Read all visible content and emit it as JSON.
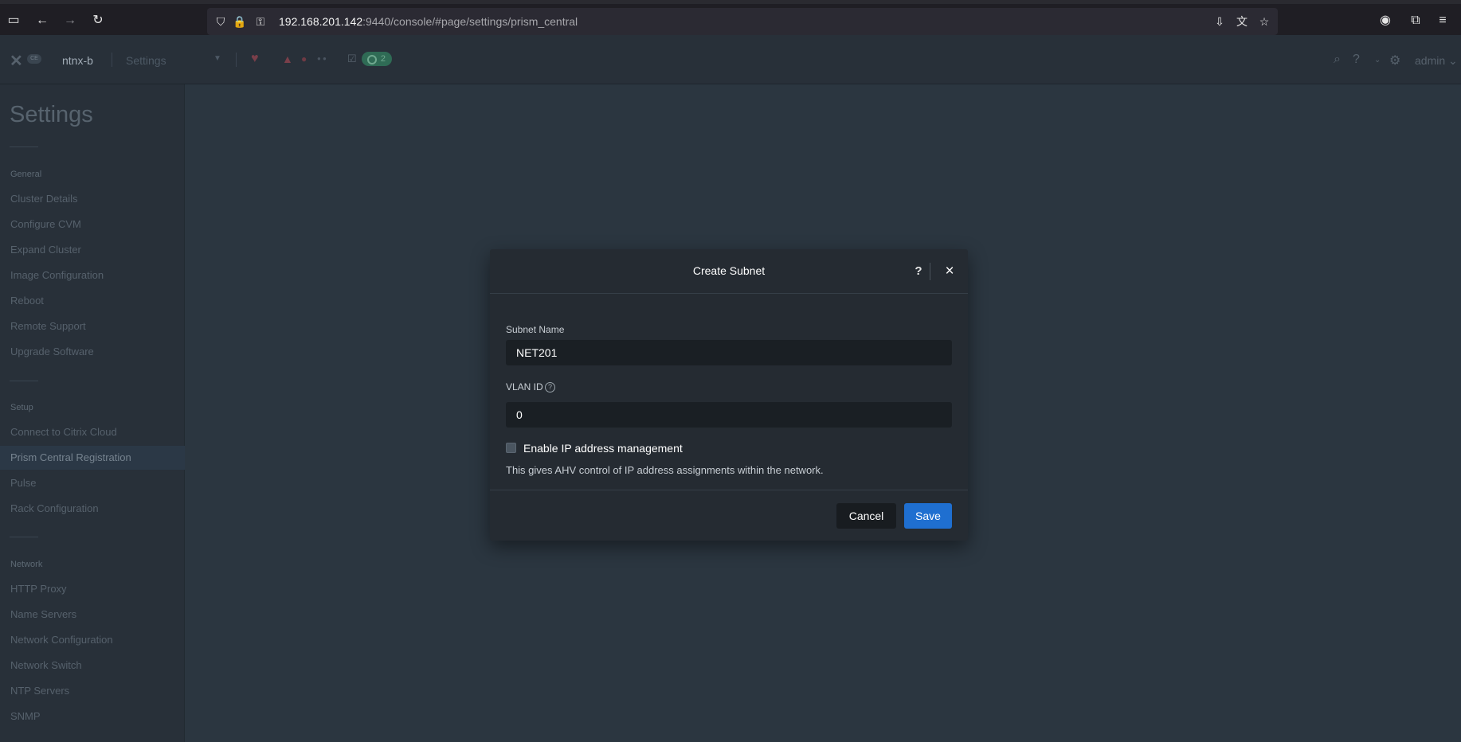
{
  "browser": {
    "url_host": "192.168.201.142",
    "url_rest": ":9440/console/#page/settings/prism_central"
  },
  "header": {
    "logo_badge": "CE",
    "cluster_name": "ntnx-b",
    "settings_dropdown": "Settings",
    "task_count": "2",
    "user": "admin"
  },
  "sidebar": {
    "title": "Settings",
    "sections": [
      {
        "header": "General",
        "items": [
          "Cluster Details",
          "Configure CVM",
          "Expand Cluster",
          "Image Configuration",
          "Reboot",
          "Remote Support",
          "Upgrade Software"
        ]
      },
      {
        "header": "Setup",
        "items": [
          "Connect to Citrix Cloud",
          "Prism Central Registration",
          "Pulse",
          "Rack Configuration"
        ]
      },
      {
        "header": "Network",
        "items": [
          "HTTP Proxy",
          "Name Servers",
          "Network Configuration",
          "Network Switch",
          "NTP Servers",
          "SNMP"
        ]
      }
    ],
    "active_item": "Prism Central Registration"
  },
  "modal": {
    "title": "Create Subnet",
    "help_glyph": "?",
    "close_glyph": "×",
    "subnet_name_label": "Subnet Name",
    "subnet_name_value": "NET201",
    "vlan_label": "VLAN ID",
    "vlan_value": "0",
    "ipam_checked": false,
    "ipam_label": "Enable IP address management",
    "ipam_help": "This gives AHV control of IP address assignments within the network.",
    "cancel_label": "Cancel",
    "save_label": "Save",
    "save_color": "#1f6fd0"
  }
}
